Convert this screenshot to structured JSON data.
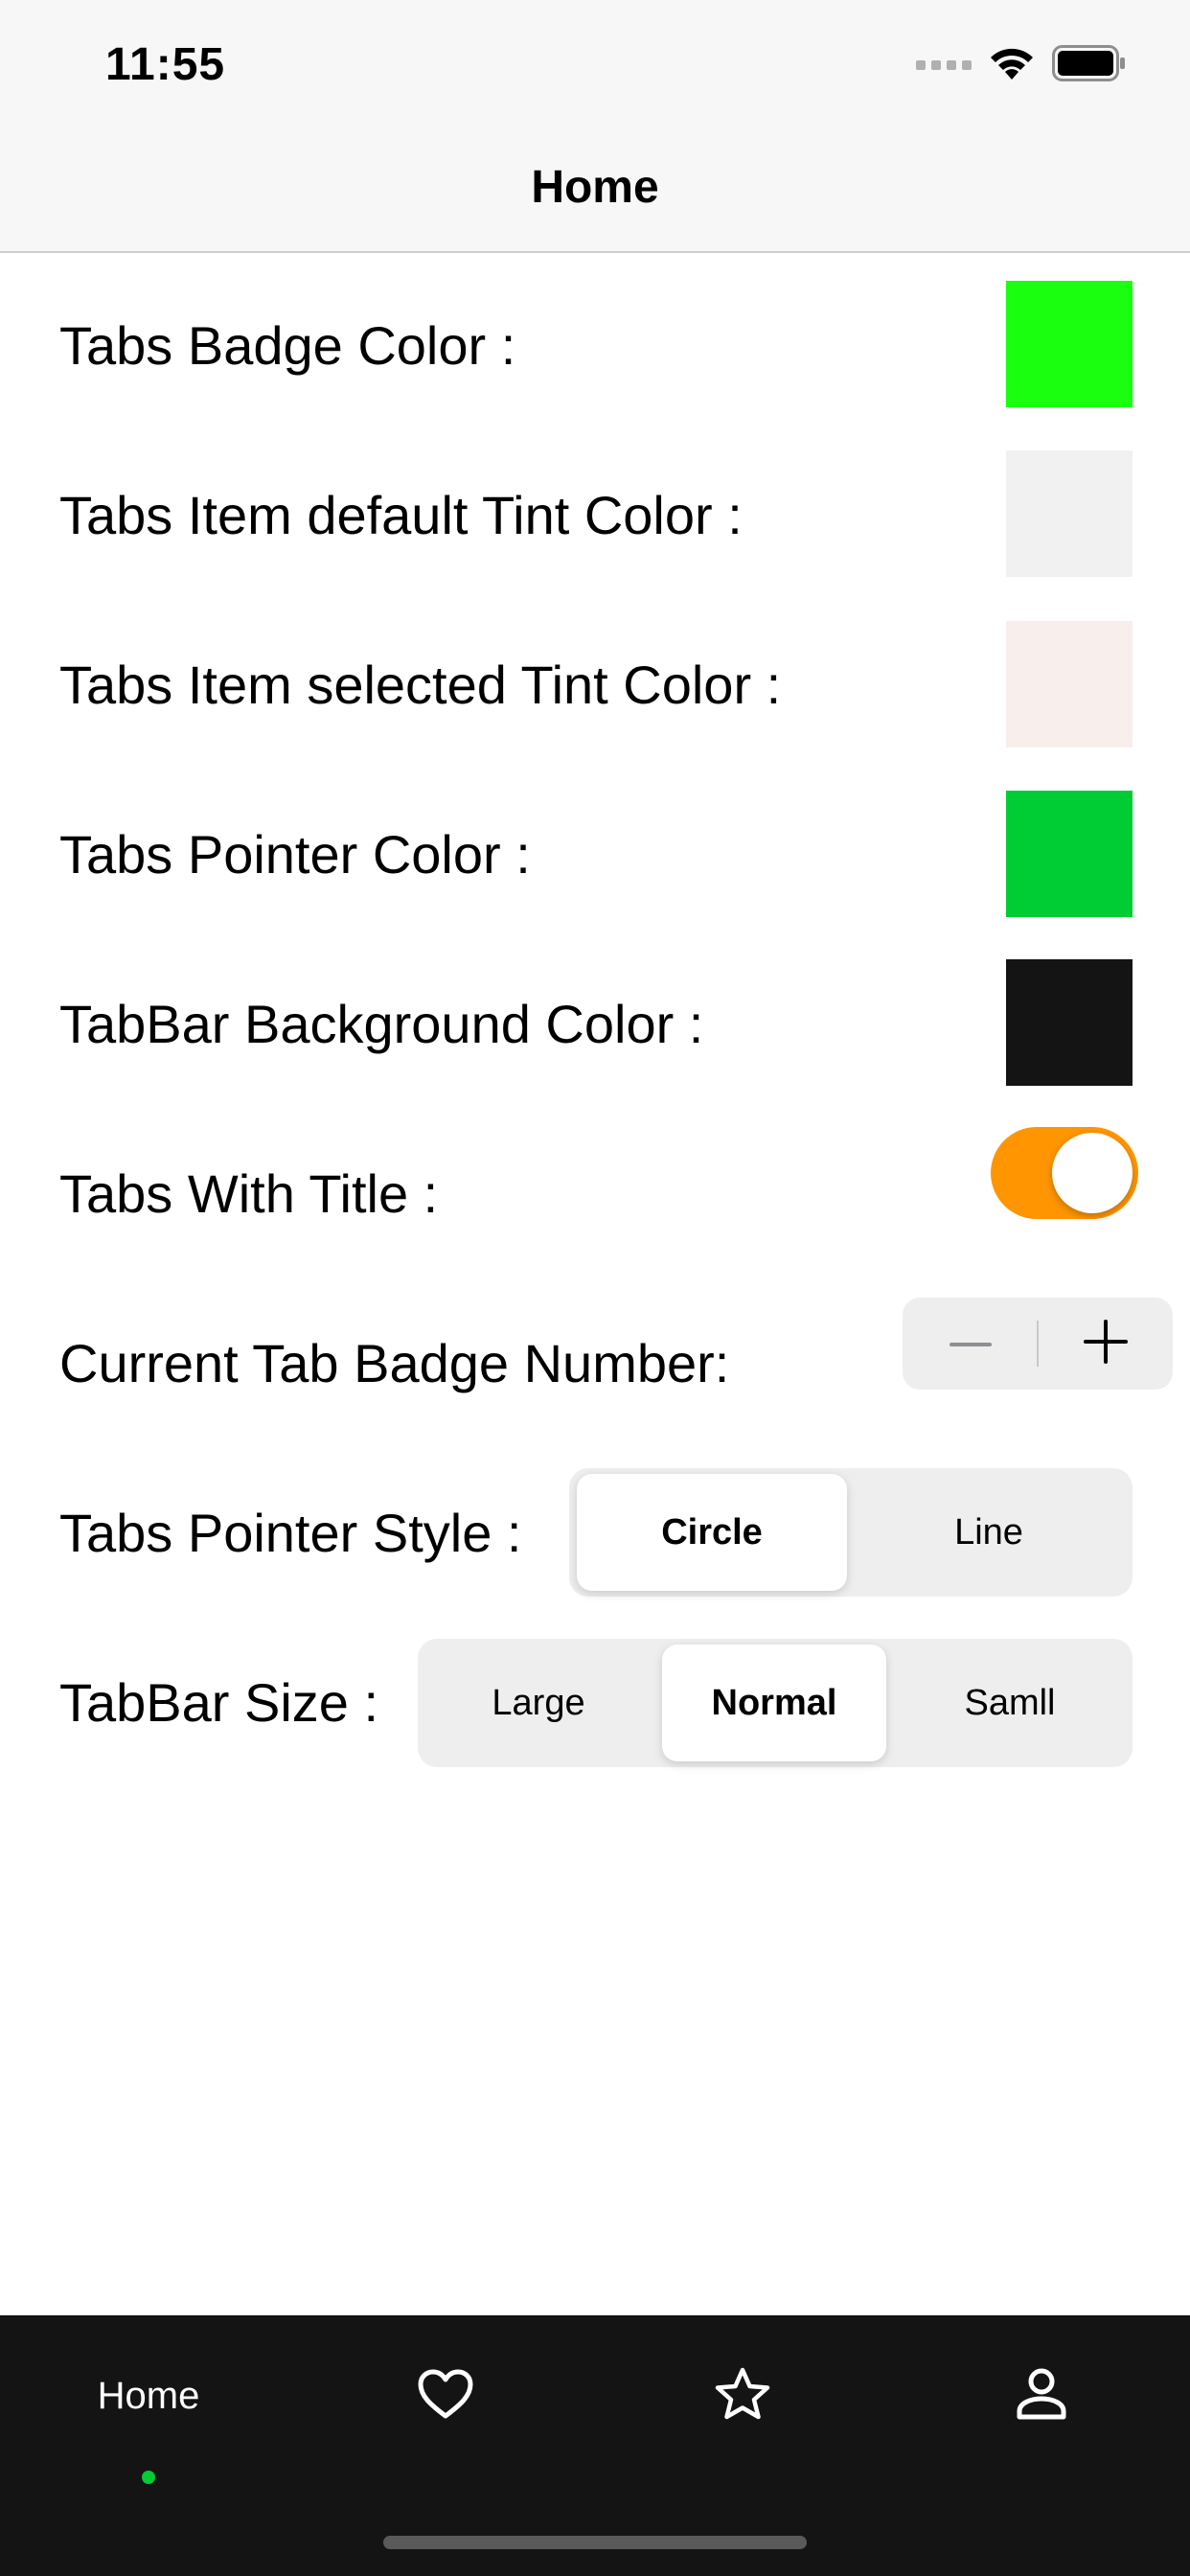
{
  "status_bar": {
    "time": "11:55"
  },
  "nav": {
    "title": "Home"
  },
  "settings": {
    "badge_color_label": "Tabs Badge Color :",
    "badge_color": "#1aff0f",
    "default_tint_label": "Tabs Item default Tint Color :",
    "default_tint": "#f1f1f1",
    "selected_tint_label": "Tabs Item selected Tint Color :",
    "selected_tint": "#f8efec",
    "pointer_color_label": "Tabs Pointer Color :",
    "pointer_color": "#00cc33",
    "tabbar_bg_label": "TabBar Background Color :",
    "tabbar_bg": "#141414",
    "with_title_label": "Tabs With Title :",
    "with_title": true,
    "badge_number_label": "Current Tab Badge Number:",
    "pointer_style_label": "Tabs Pointer Style :",
    "pointer_style_options": [
      "Circle",
      "Line"
    ],
    "pointer_style_selected": "Circle",
    "tabbar_size_label": "TabBar Size :",
    "tabbar_size_options": [
      "Large",
      "Normal",
      "Samll"
    ],
    "tabbar_size_selected": "Normal"
  },
  "tab_bar": {
    "home_label": "Home",
    "items": [
      {
        "icon": "home-tab",
        "label": "Home",
        "selected": true
      },
      {
        "icon": "heart-icon"
      },
      {
        "icon": "star-icon"
      },
      {
        "icon": "person-icon"
      }
    ],
    "accent": "#00cc33"
  },
  "colors": {
    "toggle_on": "#ff9500"
  }
}
